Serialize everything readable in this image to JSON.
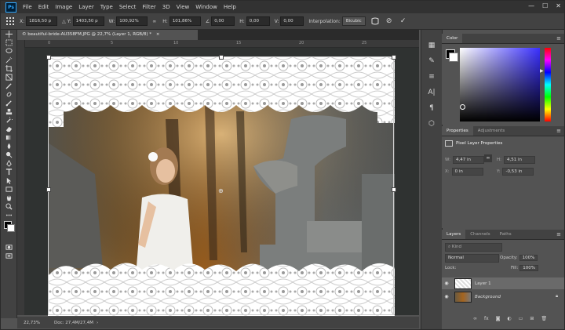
{
  "app": {
    "logo": "Ps"
  },
  "menu": [
    "File",
    "Edit",
    "Image",
    "Layer",
    "Type",
    "Select",
    "Filter",
    "3D",
    "View",
    "Window",
    "Help"
  ],
  "window_controls": {
    "minimize": "—",
    "maximize": "☐",
    "close": "✕"
  },
  "options_bar": {
    "x_label": "X:",
    "x_value": "1816,50 p",
    "y_label": "Y:",
    "y_value": "1403,50 p",
    "w_label": "W:",
    "w_value": "100,92%",
    "h_label": "H:",
    "h_value": "101,86%",
    "angle_value": "0,00",
    "h_skew_label": "H:",
    "h_skew_value": "0,00",
    "v_skew_label": "V:",
    "v_skew_value": "0,00",
    "interpolation_label": "Interpolation:",
    "interpolation_value": "Bicubic",
    "commit": "✓",
    "cancel": "⊘"
  },
  "document": {
    "tab_title": "© beautiful-bride-AU358FM.JPG @ 22,7% (Layer 1, RGB/8) *",
    "close": "×",
    "ruler_marks": [
      "0",
      "5",
      "10",
      "15",
      "20",
      "25"
    ],
    "zoom": "22,73%",
    "doc_size": "Doc: 27,4M/27,4M"
  },
  "color_panel": {
    "tab": "Color"
  },
  "properties_panel": {
    "tabs": [
      "Properties",
      "Adjustments"
    ],
    "section_title": "Pixel Layer Properties",
    "w_label": "W:",
    "w_value": "4,47 in",
    "h_label": "H:",
    "h_value": "4,51 in",
    "x_label": "X:",
    "x_value": "0 in",
    "y_label": "Y:",
    "y_value": "-0,53 in",
    "link_icon": "∞"
  },
  "layers_panel": {
    "tabs": [
      "Layers",
      "Channels",
      "Paths"
    ],
    "filter_placeholder": "Kind",
    "blend_mode": "Normal",
    "opacity_label": "Opacity:",
    "opacity_value": "100%",
    "lock_label": "Lock:",
    "fill_label": "Fill:",
    "fill_value": "100%",
    "layers": [
      {
        "name": "Layer 1",
        "selected": true
      },
      {
        "name": "Background",
        "selected": false,
        "locked": true
      }
    ],
    "footer_icons": [
      "link-icon",
      "fx-icon",
      "mask-icon",
      "adjustment-icon",
      "group-icon",
      "new-layer-icon",
      "trash-icon"
    ]
  },
  "colors": {
    "accent": "#31a8ff",
    "panel": "#535353",
    "chrome": "#323232"
  }
}
